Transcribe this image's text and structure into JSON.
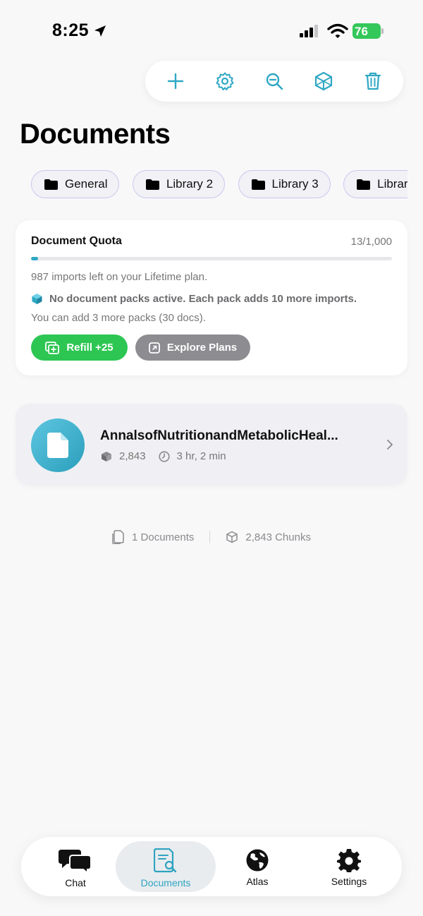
{
  "status_bar": {
    "time": "8:25",
    "battery": "76"
  },
  "toolbar": {
    "buttons": [
      "add-icon",
      "gear-icon",
      "search-icon",
      "box-icon",
      "trash-icon"
    ]
  },
  "page": {
    "title": "Documents"
  },
  "libraries": [
    "General",
    "Library 2",
    "Library 3",
    "Library"
  ],
  "quota": {
    "title": "Document Quota",
    "count": "13/1,000",
    "progress_fraction": 0.013,
    "imports_left": "987 imports left on your Lifetime plan.",
    "packs_notice": "No document packs active. Each pack adds 10 more imports.",
    "packs_more": "You can add 3 more packs (30 docs).",
    "refill_label": "Refill +25",
    "plans_label": "Explore Plans"
  },
  "document": {
    "title": "AnnalsofNutritionandMetabolicHeal...",
    "chunks": "2,843",
    "duration": "3 hr, 2 min"
  },
  "summary": {
    "documents": "1 Documents",
    "chunks": "2,843 Chunks"
  },
  "tabs": [
    {
      "label": "Chat"
    },
    {
      "label": "Documents"
    },
    {
      "label": "Atlas"
    },
    {
      "label": "Settings"
    }
  ],
  "colors": {
    "accent": "#2fa8c4",
    "refill": "#2dc653",
    "plans": "#8d8d91",
    "battery": "#34c759"
  }
}
